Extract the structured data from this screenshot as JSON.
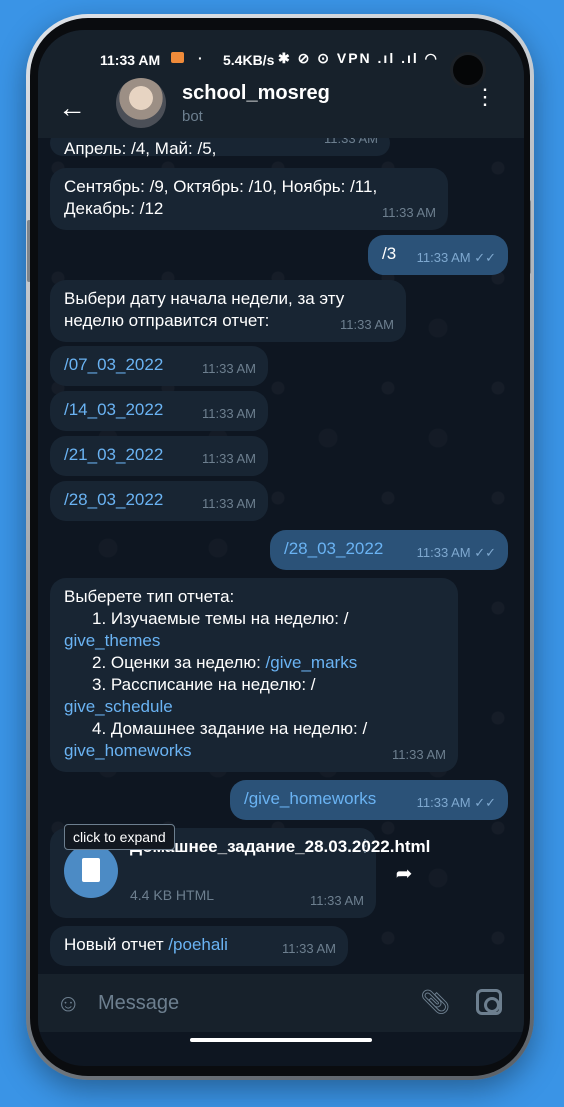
{
  "status": {
    "time": "11:33 AM",
    "dot": "·",
    "network_speed": "5.4KB/s",
    "indicators": "✱ ⊘ ⊙ VPN .ıl .ıl ◠"
  },
  "header": {
    "back_icon": "←",
    "title": "school_mosreg",
    "subtitle": "bot",
    "menu_icon": "⋮"
  },
  "messages": {
    "top_partial": {
      "text": "Апрель: /4, Май: /5,",
      "time": "11:33 AM"
    },
    "months": {
      "line": "Сентябрь: /9, Октябрь: /10, Ноябрь: /11, Декабрь: /12",
      "time": "11:33 AM"
    },
    "out_3": {
      "text": "/3",
      "time": "11:33 AM",
      "status": "✓✓"
    },
    "select_date": {
      "text": "Выбери дату начала недели, за эту неделю отправится отчет:",
      "time": "11:33 AM"
    },
    "date_options": [
      {
        "text": "/07_03_2022",
        "time": "11:33 AM"
      },
      {
        "text": "/14_03_2022",
        "time": "11:33 AM"
      },
      {
        "text": "/21_03_2022",
        "time": "11:33 AM"
      },
      {
        "text": "/28_03_2022",
        "time": "11:33 AM"
      }
    ],
    "out_date": {
      "text": "/28_03_2022",
      "time": "11:33 AM",
      "status": "✓✓"
    },
    "report_types": {
      "title": "Выберете тип отчета:",
      "items": [
        {
          "prefix": "1. Изучаемые темы на неделю: /",
          "command": "give_themes"
        },
        {
          "prefix": "2. Оценки за неделю: ",
          "command": "/give_marks"
        },
        {
          "prefix": "3. Рассписание на неделю: /",
          "command": "give_schedule"
        },
        {
          "prefix": "4. Домашнее задание на неделю: /",
          "command": "give_homeworks"
        }
      ],
      "time": "11:33 AM"
    },
    "out_homeworks": {
      "text": "/give_homeworks",
      "time": "11:33 AM",
      "status": "✓✓"
    },
    "file": {
      "tooltip": "click to expand",
      "name": "Домашнее_задание_28.03.2022.html",
      "meta": "4.4 KB HTML",
      "time": "11:33 AM"
    },
    "new_report": {
      "text": "Новый отчет ",
      "command": "/poehali",
      "time": "11:33 AM"
    }
  },
  "input": {
    "placeholder": "Message",
    "emoji_icon": "☺",
    "attach_icon": "⌒",
    "camera_icon": "camera-icon"
  },
  "colors": {
    "background": "#3a94e6",
    "chat_bg": "#0e1621",
    "incoming_bubble": "#182533",
    "outgoing_bubble": "#2b5278",
    "link": "#6ab3f3"
  }
}
